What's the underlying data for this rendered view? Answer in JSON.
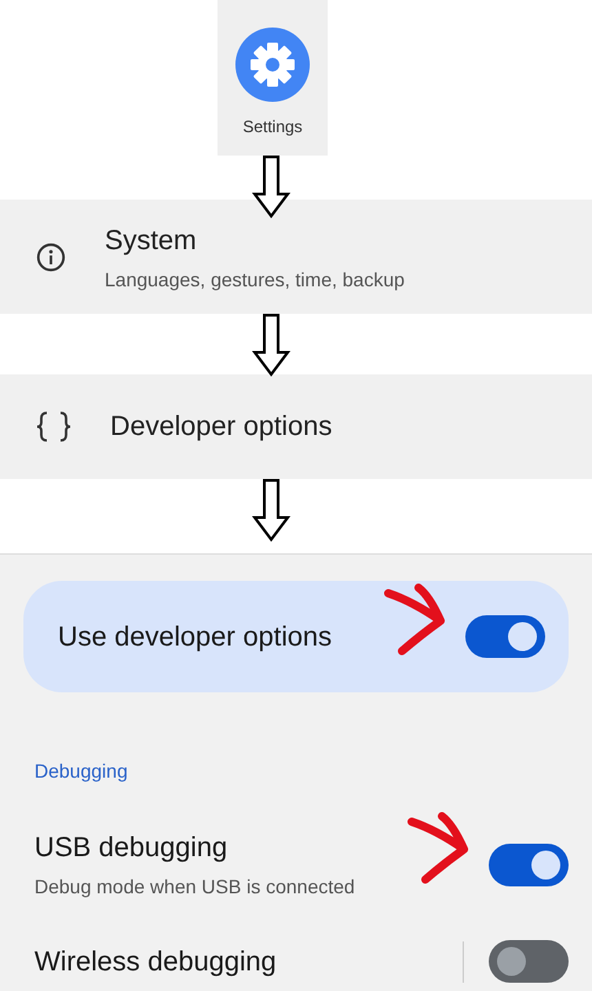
{
  "launcher": {
    "app_label": "Settings"
  },
  "menu_items": [
    {
      "kind": "system",
      "title": "System",
      "subtitle": "Languages, gestures, time, backup"
    },
    {
      "kind": "developer",
      "title": "Developer options"
    }
  ],
  "developer_screen": {
    "master_switch": {
      "label": "Use developer options",
      "on": true,
      "annotated": true
    },
    "section_header": "Debugging",
    "settings": [
      {
        "title": "USB debugging",
        "subtitle": "Debug mode when USB is connected",
        "on": true,
        "annotated": true,
        "divider": false
      },
      {
        "title": "Wireless debugging",
        "on": false,
        "annotated": false,
        "divider": true
      }
    ]
  }
}
